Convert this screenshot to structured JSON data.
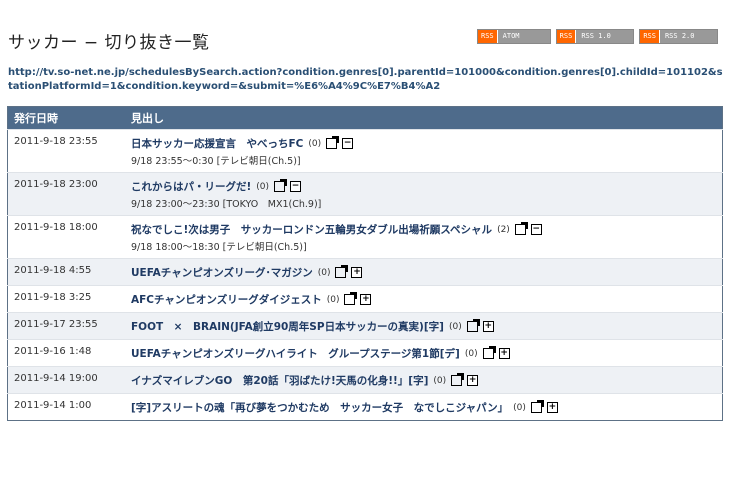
{
  "page": {
    "title": "サッカー − 切り抜き一覧"
  },
  "feeds": [
    {
      "badge": "RSS",
      "label": "ATOM"
    },
    {
      "badge": "RSS",
      "label": "RSS 1.0"
    },
    {
      "badge": "RSS",
      "label": "RSS 2.0"
    }
  ],
  "query_url": "http://tv.so-net.ne.jp/schedulesBySearch.action?condition.genres[0].parentId=101000&condition.genres[0].childId=101102&stationPlatformId=1&condition.keyword=&submit=%E6%A4%9C%E7%B4%A2",
  "table": {
    "headers": {
      "date": "発行日時",
      "title": "見出し"
    },
    "rows": [
      {
        "date": "2011-9-18 23:55",
        "title": "日本サッカー応援宣言　やべっちFC",
        "count": "(0)",
        "toggle": "−",
        "airtime": "9/18 23:55〜0:30 [テレビ朝日(Ch.5)]"
      },
      {
        "date": "2011-9-18 23:00",
        "title": "これからはパ・リーグだ!",
        "count": "(0)",
        "toggle": "−",
        "airtime": "9/18 23:00〜23:30 [TOKYO　MX1(Ch.9)]"
      },
      {
        "date": "2011-9-18 18:00",
        "title": "祝なでしこ!次は男子　サッカーロンドン五輪男女ダブル出場祈願スペシャル",
        "count": "(2)",
        "toggle": "−",
        "airtime": "9/18 18:00〜18:30 [テレビ朝日(Ch.5)]"
      },
      {
        "date": "2011-9-18 4:55",
        "title": "UEFAチャンピオンズリーグ･マガジン",
        "count": "(0)",
        "toggle": "+",
        "airtime": ""
      },
      {
        "date": "2011-9-18 3:25",
        "title": "AFCチャンピオンズリーグダイジェスト",
        "count": "(0)",
        "toggle": "+",
        "airtime": ""
      },
      {
        "date": "2011-9-17 23:55",
        "title": "FOOT　×　BRAIN(JFA創立90周年SP日本サッカーの真実)[字]",
        "count": "(0)",
        "toggle": "+",
        "airtime": ""
      },
      {
        "date": "2011-9-16 1:48",
        "title": "UEFAチャンピオンズリーグハイライト　グループステージ第1節[デ]",
        "count": "(0)",
        "toggle": "+",
        "airtime": ""
      },
      {
        "date": "2011-9-14 19:00",
        "title": "イナズマイレブンGO　第20話「羽ばたけ!天馬の化身!!」[字]",
        "count": "(0)",
        "toggle": "+",
        "airtime": ""
      },
      {
        "date": "2011-9-14 1:00",
        "title": "[字]アスリートの魂「再び夢をつかむため　サッカー女子　なでしこジャパン」",
        "count": "(0)",
        "toggle": "+",
        "airtime": ""
      }
    ]
  }
}
